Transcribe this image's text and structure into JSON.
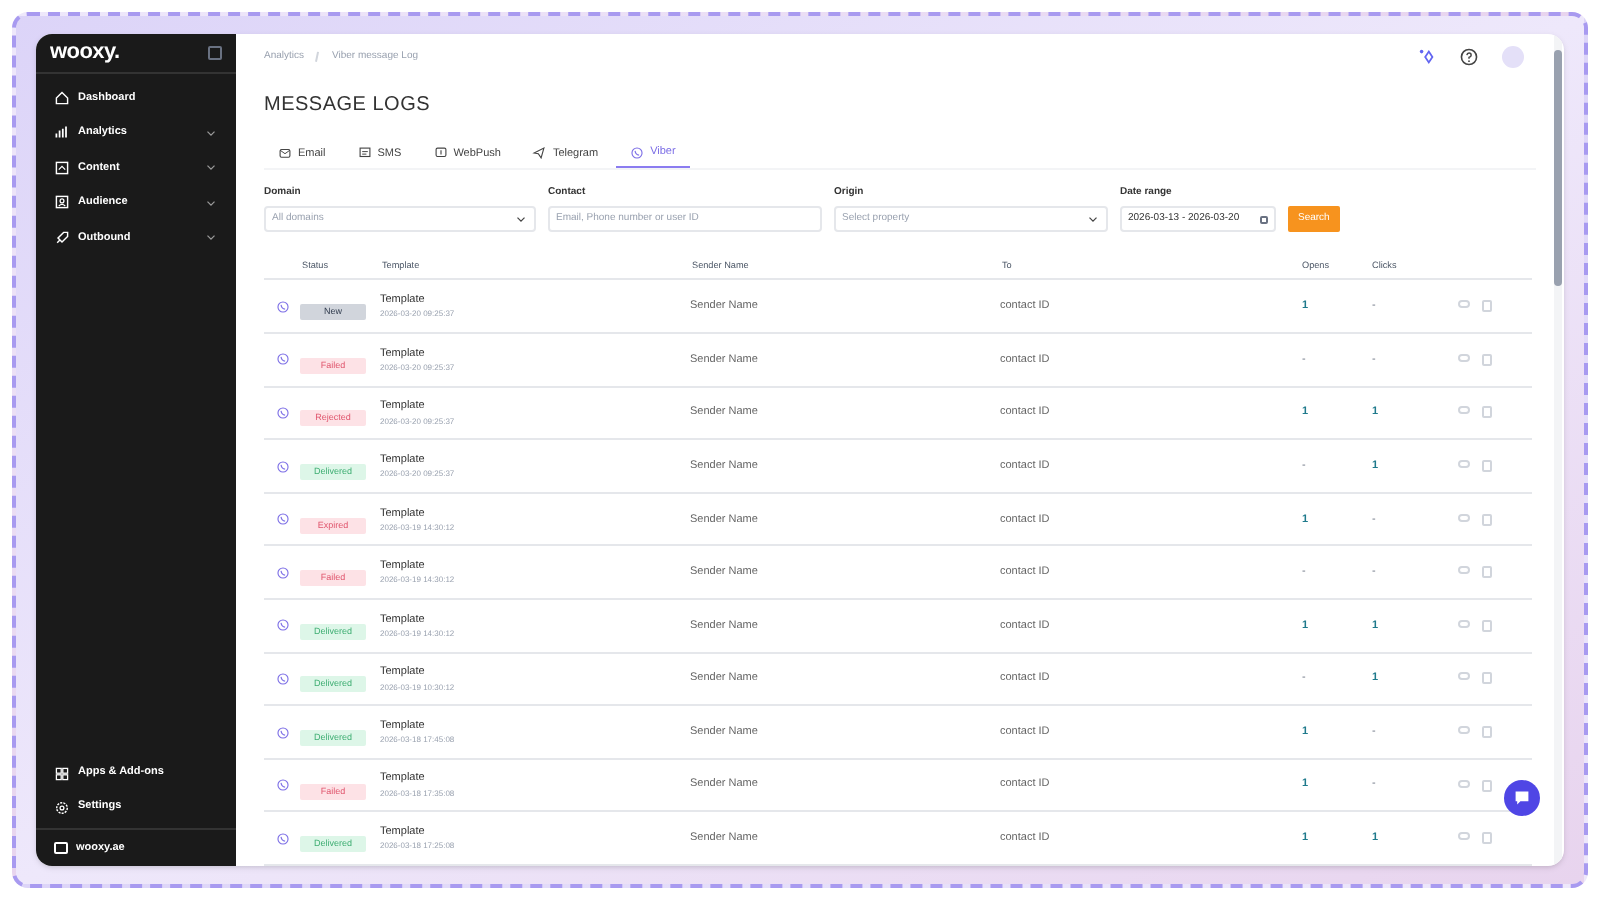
{
  "sidebar": {
    "logo": "wooxy.",
    "items": [
      {
        "label": "Dashboard",
        "expandable": false
      },
      {
        "label": "Analytics",
        "expandable": true
      },
      {
        "label": "Content",
        "expandable": true
      },
      {
        "label": "Audience",
        "expandable": true
      },
      {
        "label": "Outbound",
        "expandable": true
      }
    ],
    "bottom_items": [
      {
        "label": "Apps & Add-ons"
      },
      {
        "label": "Settings"
      }
    ],
    "account": "wooxy.ae"
  },
  "breadcrumb": [
    "Analytics",
    "Viber message Log"
  ],
  "title": "MESSAGE LOGS",
  "tabs": [
    {
      "label": "Email",
      "selected": false
    },
    {
      "label": "SMS",
      "selected": false
    },
    {
      "label": "WebPush",
      "selected": false
    },
    {
      "label": "Telegram",
      "selected": false
    },
    {
      "label": "Viber",
      "selected": true
    }
  ],
  "filters": {
    "domain": {
      "label": "Domain",
      "placeholder": "All domains"
    },
    "contact": {
      "label": "Contact",
      "placeholder": "Email, Phone number or user ID"
    },
    "origin": {
      "label": "Origin",
      "placeholder": "Select property"
    },
    "date_range": {
      "label": "Date range",
      "value": "2026-03-13 - 2026-03-20"
    },
    "search_button": "Search"
  },
  "table": {
    "columns": [
      "Status",
      "Template",
      "Sender Name",
      "To",
      "Opens",
      "Clicks"
    ],
    "rows": [
      {
        "status": "New",
        "kind": "new",
        "template": "Template",
        "time": "2026-03-20 09:25:37",
        "sender": "Sender Name",
        "to": "contact ID",
        "opens": {
          "text": "1",
          "muted": false
        },
        "clicks": {
          "text": "-",
          "muted": true
        }
      },
      {
        "status": "Failed",
        "kind": "failed",
        "template": "Template",
        "time": "2026-03-20 09:25:37",
        "sender": "Sender Name",
        "to": "contact ID",
        "opens": {
          "text": "-",
          "muted": true
        },
        "clicks": {
          "text": "-",
          "muted": true
        }
      },
      {
        "status": "Rejected",
        "kind": "failed",
        "template": "Template",
        "time": "2026-03-20 09:25:37",
        "sender": "Sender Name",
        "to": "contact ID",
        "opens": {
          "text": "1",
          "muted": false
        },
        "clicks": {
          "text": "1",
          "muted": false
        }
      },
      {
        "status": "Delivered",
        "kind": "delivered",
        "template": "Template",
        "time": "2026-03-20 09:25:37",
        "sender": "Sender Name",
        "to": "contact ID",
        "opens": {
          "text": "-",
          "muted": true
        },
        "clicks": {
          "text": "1",
          "muted": false
        }
      },
      {
        "status": "Expired",
        "kind": "failed",
        "template": "Template",
        "time": "2026-03-19 14:30:12",
        "sender": "Sender Name",
        "to": "contact ID",
        "opens": {
          "text": "1",
          "muted": false
        },
        "clicks": {
          "text": "-",
          "muted": true
        }
      },
      {
        "status": "Failed",
        "kind": "failed",
        "template": "Template",
        "time": "2026-03-19 14:30:12",
        "sender": "Sender Name",
        "to": "contact ID",
        "opens": {
          "text": "-",
          "muted": true
        },
        "clicks": {
          "text": "-",
          "muted": true
        }
      },
      {
        "status": "Delivered",
        "kind": "delivered",
        "template": "Template",
        "time": "2026-03-19 14:30:12",
        "sender": "Sender Name",
        "to": "contact ID",
        "opens": {
          "text": "1",
          "muted": false
        },
        "clicks": {
          "text": "1",
          "muted": false
        }
      },
      {
        "status": "Delivered",
        "kind": "delivered",
        "template": "Template",
        "time": "2026-03-19 10:30:12",
        "sender": "Sender Name",
        "to": "contact ID",
        "opens": {
          "text": "-",
          "muted": true
        },
        "clicks": {
          "text": "1",
          "muted": false
        }
      },
      {
        "status": "Delivered",
        "kind": "delivered",
        "template": "Template",
        "time": "2026-03-18 17:45:08",
        "sender": "Sender Name",
        "to": "contact ID",
        "opens": {
          "text": "1",
          "muted": false
        },
        "clicks": {
          "text": "-",
          "muted": true
        }
      },
      {
        "status": "Failed",
        "kind": "failed",
        "template": "Template",
        "time": "2026-03-18 17:35:08",
        "sender": "Sender Name",
        "to": "contact ID",
        "opens": {
          "text": "1",
          "muted": false
        },
        "clicks": {
          "text": "-",
          "muted": true
        }
      },
      {
        "status": "Delivered",
        "kind": "delivered",
        "template": "Template",
        "time": "2026-03-18 17:25:08",
        "sender": "Sender Name",
        "to": "contact ID",
        "opens": {
          "text": "1",
          "muted": false
        },
        "clicks": {
          "text": "1",
          "muted": false
        }
      }
    ]
  }
}
